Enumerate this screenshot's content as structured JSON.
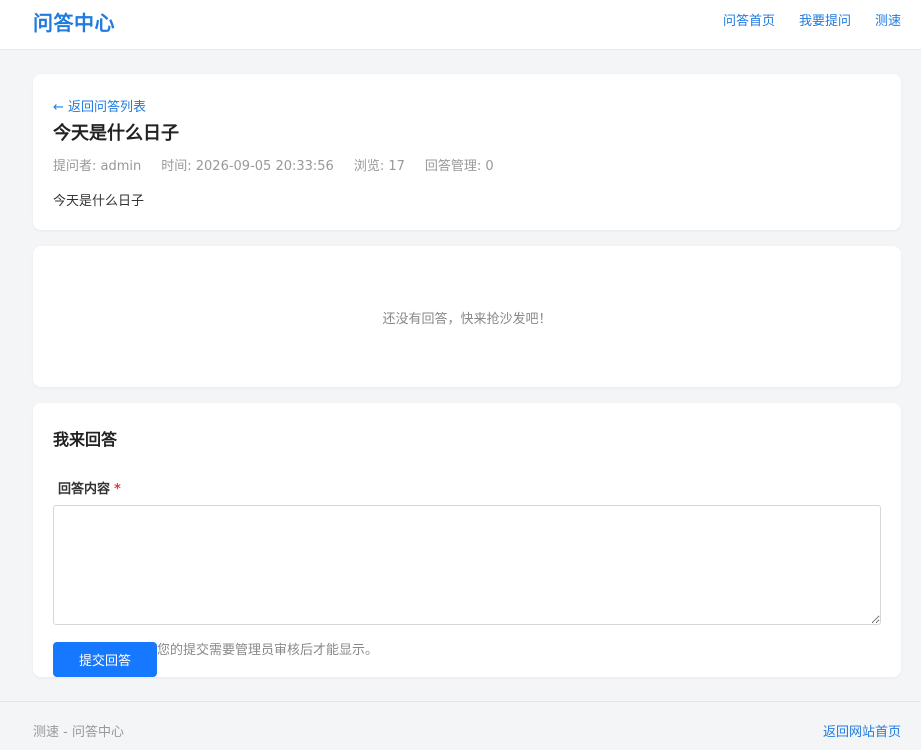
{
  "header": {
    "brand": "问答中心",
    "nav": [
      {
        "label": "问答首页"
      },
      {
        "label": "我要提问"
      },
      {
        "label": "测速"
      }
    ]
  },
  "question": {
    "back_link": "← 返回问答列表",
    "title": "今天是什么日子",
    "meta": {
      "author": "提问者: admin",
      "time": "时间: 2026-09-05 20:33:56",
      "views": "浏览: 17",
      "manage": "回答管理: 0"
    },
    "body": "今天是什么日子"
  },
  "answers": {
    "empty_text": "还没有回答，快来抢沙发吧！"
  },
  "answer_form": {
    "title": "我来回答",
    "field_label": "回答内容",
    "required_mark": "*",
    "value": "",
    "placeholder": "",
    "note": "您的提交需要管理员审核后才能显示。",
    "submit_label": "提交回答"
  },
  "footer": {
    "text": "测速 - 问答中心",
    "link": "返回网站首页"
  },
  "colors": {
    "accent": "#1f7be0",
    "button": "#1677ff",
    "required": "#e53935",
    "background": "#f4f5f7"
  }
}
